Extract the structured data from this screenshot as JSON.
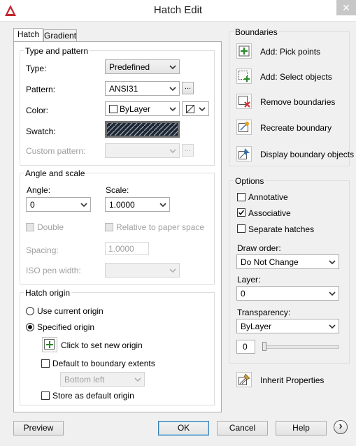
{
  "window": {
    "title": "Hatch Edit",
    "close_glyph": "✕"
  },
  "tabs": [
    {
      "label": "Hatch"
    },
    {
      "label": "Gradient"
    }
  ],
  "type_pattern": {
    "group_label": "Type and pattern",
    "type_label": "Type:",
    "type_value": "Predefined",
    "pattern_label": "Pattern:",
    "pattern_value": "ANSI31",
    "browse_label": "...",
    "color_label": "Color:",
    "color_value": "ByLayer",
    "swatch_label": "Swatch:",
    "custom_label": "Custom pattern:",
    "custom_value": "",
    "custom_browse_label": "..."
  },
  "angle_scale": {
    "group_label": "Angle and scale",
    "angle_label": "Angle:",
    "angle_value": "0",
    "scale_label": "Scale:",
    "scale_value": "1.0000",
    "double_label": "Double",
    "relative_label": "Relative to paper space",
    "spacing_label": "Spacing:",
    "spacing_value": "1.0000",
    "iso_label": "ISO pen width:",
    "iso_value": ""
  },
  "hatch_origin": {
    "group_label": "Hatch origin",
    "use_current_label": "Use current origin",
    "specified_label": "Specified origin",
    "click_set_label": "Click to set new origin",
    "default_extents_label": "Default to boundary extents",
    "extents_value": "Bottom left",
    "store_default_label": "Store as default origin",
    "selected": "specified"
  },
  "boundaries": {
    "group_label": "Boundaries",
    "items": [
      {
        "label": "Add: Pick points",
        "icon": "pick-points-icon"
      },
      {
        "label": "Add: Select objects",
        "icon": "select-objects-icon"
      },
      {
        "label": "Remove boundaries",
        "icon": "remove-boundaries-icon"
      },
      {
        "label": "Recreate boundary",
        "icon": "recreate-boundary-icon"
      },
      {
        "label": "Display boundary objects",
        "icon": "display-boundary-icon"
      }
    ]
  },
  "options": {
    "group_label": "Options",
    "annotative_label": "Annotative",
    "annotative_checked": false,
    "associative_label": "Associative",
    "associative_checked": true,
    "separate_label": "Separate hatches",
    "separate_checked": false,
    "draw_order_label": "Draw order:",
    "draw_order_value": "Do Not Change",
    "layer_label": "Layer:",
    "layer_value": "0",
    "transparency_label": "Transparency:",
    "transparency_value": "ByLayer",
    "transparency_amount": "0",
    "transparency_slider_fraction": 0
  },
  "inherit": {
    "label": "Inherit Properties"
  },
  "footer": {
    "preview_label": "Preview",
    "ok_label": "OK",
    "cancel_label": "Cancel",
    "help_label": "Help",
    "more_glyph": "›"
  },
  "colors": {
    "accent_green": "#2a8a2a",
    "accent_red": "#d23030",
    "default_border": "#3c7fb1"
  }
}
